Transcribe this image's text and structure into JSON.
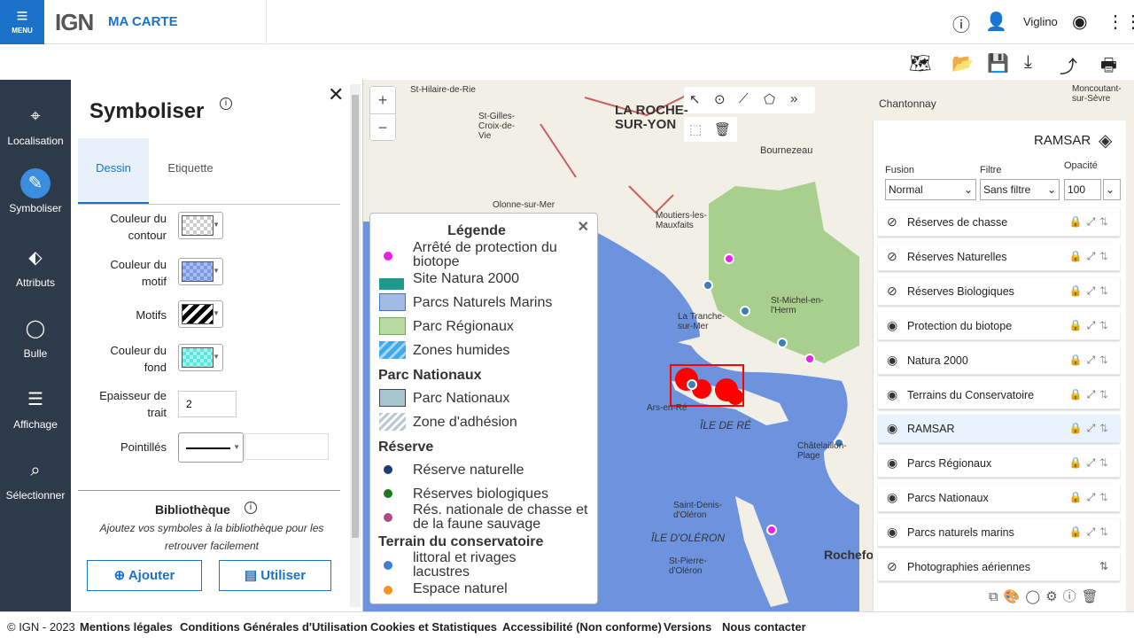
{
  "header": {
    "menu_label": "MENU",
    "logo": "IGN",
    "brand": "MA CARTE",
    "user": "Viglino"
  },
  "rail": [
    {
      "label": "Localisation",
      "icon": "map-pin-icon"
    },
    {
      "label": "Symboliser",
      "icon": "pencil-icon"
    },
    {
      "label": "Attributs",
      "icon": "tag-icon"
    },
    {
      "label": "Bulle",
      "icon": "speech-bubble-icon"
    },
    {
      "label": "Affichage",
      "icon": "list-icon"
    },
    {
      "label": "Sélectionner",
      "icon": "magnify-select-icon"
    }
  ],
  "panel": {
    "title": "Symboliser",
    "tabs": [
      "Dessin",
      "Etiquette"
    ],
    "fields": {
      "contour": "Couleur du contour",
      "motif_color": "Couleur du motif",
      "motifs": "Motifs",
      "fond": "Couleur du fond",
      "epaisseur": "Epaisseur de trait",
      "epaisseur_value": "2",
      "pointilles": "Pointillés"
    },
    "library": {
      "title": "Bibliothèque",
      "desc": "Ajoutez vos symboles à la bibliothèque pour les retrouver facilement",
      "add": "Ajouter",
      "use": "Utiliser"
    }
  },
  "legend": {
    "title": "Légende",
    "r1": "Arrêté de protection du biotope",
    "r2": "Site Natura 2000",
    "r3": "Parcs Naturels Marins",
    "r4": "Parc Régionaux",
    "r5": "Zones humides",
    "h1": "Parc Nationaux",
    "r6": "Parc Nationaux",
    "r7": "Zone d'adhésion",
    "h2": "Réserve",
    "r8": "Réserve naturelle",
    "r9": "Réserves biologiques",
    "r10": "Rés. nationale de chasse et de la faune sauvage",
    "h3": "Terrain du conservatoire",
    "r11": "littoral et rivages lacustres",
    "r12": "Espace naturel"
  },
  "layers_panel": {
    "title": "RAMSAR",
    "fusion_label": "Fusion",
    "fusion_value": "Normal",
    "filtre_label": "Filtre",
    "filtre_value": "Sans filtre",
    "opacite_label": "Opacité",
    "opacite_value": "100",
    "layers": [
      "Réserves de chasse",
      "Réserves Naturelles",
      "Réserves Biologiques",
      "Protection du biotope",
      "Natura 2000",
      "Terrains du Conservatoire",
      "RAMSAR",
      "Parcs Régionaux",
      "Parcs Nationaux",
      "Parcs naturels marins",
      "Photographies aériennes"
    ]
  },
  "map_labels": {
    "l1": "LA ROCHE-SUR-YON",
    "l2": "ÎLE DE RÉ",
    "l3": "ÎLE D'OLÉRON",
    "l4": "Chantonnay",
    "l5": "Bournezeau",
    "l6": "St-Hilaire-de-Rie",
    "l7": "St-Gilles-Croix-de-Vie",
    "l8": "Olonne-sur-Mer",
    "l9": "Moutiers-les-Mauxfaits",
    "l10": "La Tranche-sur-Mer",
    "l11": "Ars-en-Ré",
    "l12": "Rochefort",
    "l13": "Saint-Denis-d'Oléron",
    "l14": "St-Pierre-d'Oléron",
    "l15": "Châtelaillon-Plage",
    "l16": "St-Michel-en-l'Herm",
    "l17": "Moncoutant-sur-Sèvre"
  },
  "footer": [
    "© IGN - 2023",
    "Mentions légales",
    "Conditions Générales d'Utilisation",
    "Cookies et Statistiques",
    "Accessibilité (Non conforme)",
    "Versions",
    "Nous contacter"
  ]
}
